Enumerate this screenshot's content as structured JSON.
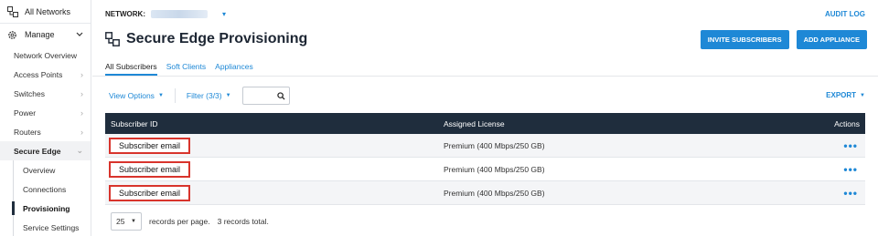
{
  "sidebar": {
    "all_networks": "All Networks",
    "manage": "Manage",
    "items": [
      {
        "label": "Network Overview",
        "chevron": false
      },
      {
        "label": "Access Points",
        "chevron": true
      },
      {
        "label": "Switches",
        "chevron": true
      },
      {
        "label": "Power",
        "chevron": true
      },
      {
        "label": "Routers",
        "chevron": true
      },
      {
        "label": "Secure Edge",
        "chevron": true
      }
    ],
    "sub_items": [
      {
        "label": "Overview"
      },
      {
        "label": "Connections"
      },
      {
        "label": "Provisioning"
      },
      {
        "label": "Service Settings"
      }
    ]
  },
  "topbar": {
    "network_label": "NETWORK:",
    "audit_log": "AUDIT LOG"
  },
  "page": {
    "title": "Secure Edge Provisioning",
    "invite_button": "INVITE SUBSCRIBERS",
    "add_button": "ADD APPLIANCE"
  },
  "tabs": [
    "All Subscribers",
    "Soft Clients",
    "Appliances"
  ],
  "toolbar": {
    "view_options": "View Options",
    "filter": "Filter (3/3)",
    "export": "EXPORT"
  },
  "table": {
    "headers": {
      "id": "Subscriber ID",
      "license": "Assigned License",
      "actions": "Actions"
    },
    "rows": [
      {
        "id": "Subscriber email",
        "license": "Premium (400 Mbps/250 GB)",
        "actions": "•••"
      },
      {
        "id": "Subscriber email",
        "license": "Premium (400 Mbps/250 GB)",
        "actions": "•••"
      },
      {
        "id": "Subscriber email",
        "license": "Premium (400 Mbps/250 GB)",
        "actions": "•••"
      }
    ]
  },
  "pager": {
    "per_page": "25",
    "per_page_label": "records per page.",
    "total": "3 records total."
  },
  "colors": {
    "accent": "#1e88d6",
    "header_bg": "#1f2d3d",
    "highlight_border": "#d8342c"
  }
}
